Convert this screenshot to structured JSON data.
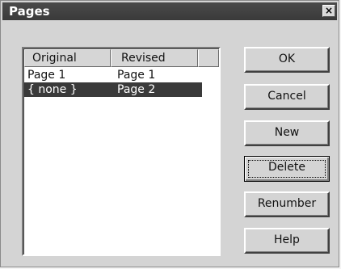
{
  "dialog": {
    "title": "Pages",
    "close_glyph": "×"
  },
  "listview": {
    "columns": [
      "Original",
      "Revised"
    ],
    "rows": [
      {
        "original": "Page 1",
        "revised": "Page 1",
        "selected": false
      },
      {
        "original": "{ none }",
        "revised": "Page 2",
        "selected": true
      }
    ]
  },
  "buttons": {
    "ok": "OK",
    "cancel": "Cancel",
    "new": "New",
    "delete": "Delete",
    "renumber": "Renumber",
    "help": "Help"
  },
  "icons": {
    "close": "close-icon"
  },
  "colors": {
    "titlebar": "#3a3a3a",
    "selection": "#3a3a3a",
    "face": "#d4d4d4"
  }
}
